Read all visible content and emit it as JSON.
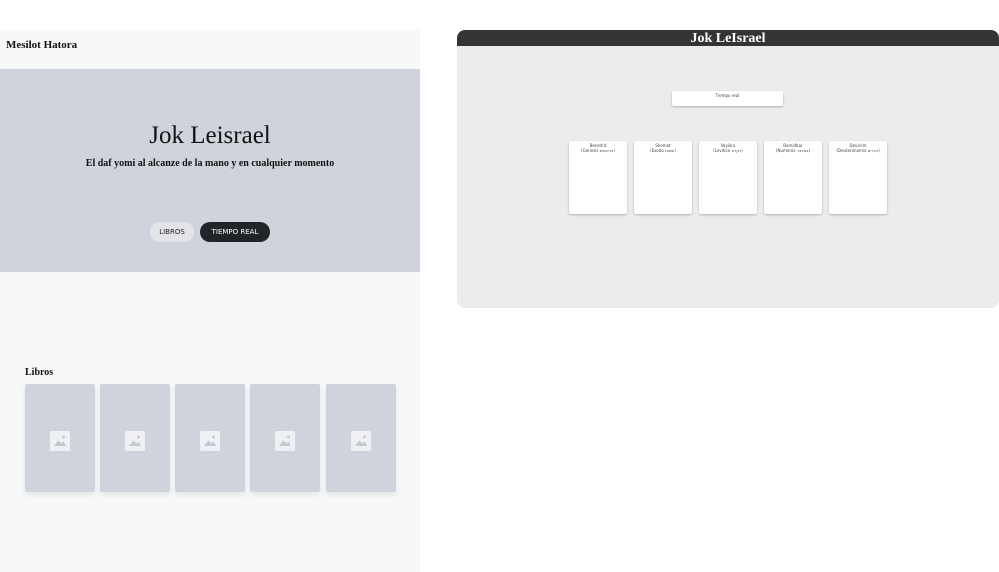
{
  "left_panel": {
    "brand": "Mesilot Hatora",
    "hero": {
      "title": "Jok Leisrael",
      "subtitle": "El daf yomi al alcanze de la mano y en cualquier momento",
      "buttons": {
        "libros": "LIBROS",
        "tiempo_real": "TIEMPO REAL"
      }
    },
    "libros_section": {
      "heading": "Libros",
      "cards": [
        {
          "icon": "image-placeholder-icon"
        },
        {
          "icon": "image-placeholder-icon"
        },
        {
          "icon": "image-placeholder-icon"
        },
        {
          "icon": "image-placeholder-icon"
        },
        {
          "icon": "image-placeholder-icon"
        }
      ]
    }
  },
  "right_window": {
    "title": "Jok LeIsrael",
    "tiempo_real_button": "Tiempo real",
    "books": [
      {
        "name": "Bereshit",
        "sub": "(Genesis בראשית)"
      },
      {
        "name": "Shemot",
        "sub": "(Exodo שמות)"
      },
      {
        "name": "Vayikra",
        "sub": "(Levitico ויקרא)"
      },
      {
        "name": "Bamidbar",
        "sub": "(Numeros במדבר)"
      },
      {
        "name": "Devarim",
        "sub": "(Deuteronomio דברים)"
      }
    ]
  },
  "colors": {
    "hero_bg": "#cfd4dc",
    "dark_button": "#212529",
    "window_bar": "#343434",
    "window_bg": "#ececec"
  }
}
